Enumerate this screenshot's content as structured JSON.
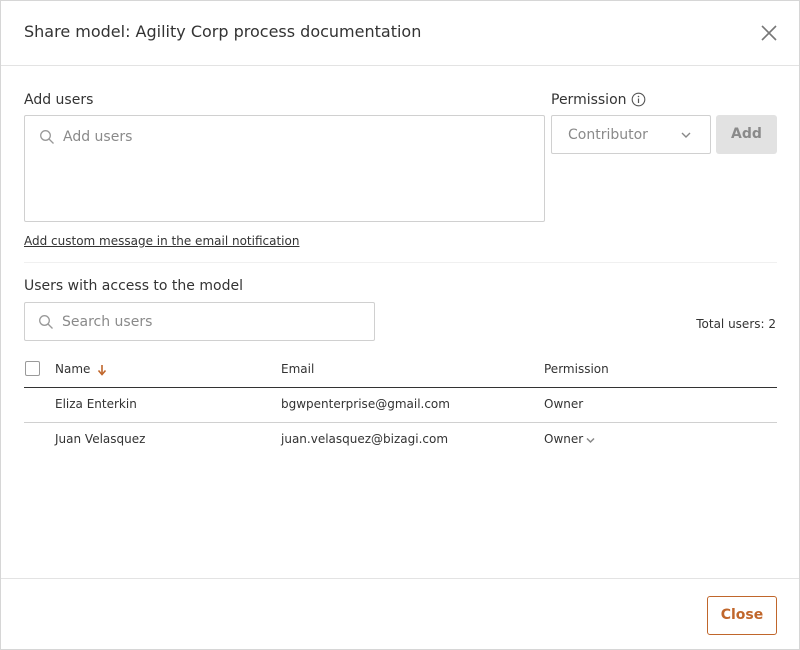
{
  "dialog": {
    "title": "Share model: Agility Corp process documentation"
  },
  "add_users": {
    "label": "Add users",
    "placeholder": "Add users",
    "custom_message_link": "Add custom message in the email notification"
  },
  "permission": {
    "label": "Permission",
    "selected": "Contributor",
    "add_label": "Add"
  },
  "access": {
    "section_label": "Users with access to the model",
    "search_placeholder": "Search users",
    "total_users": "Total users: 2",
    "columns": {
      "name": "Name",
      "email": "Email",
      "permission": "Permission"
    },
    "rows": [
      {
        "name": "Eliza Enterkin",
        "email": "bgwpenterprise@gmail.com",
        "permission": "Owner"
      },
      {
        "name": "Juan Velasquez",
        "email": "juan.velasquez@bizagi.com",
        "permission": "Owner"
      }
    ]
  },
  "footer": {
    "close_label": "Close"
  },
  "colors": {
    "accent": "#c0662b",
    "text": "#333333",
    "border": "#d0d0d0",
    "disabled_button": "#e2e2e2"
  },
  "icons": {
    "close": "close-icon",
    "search": "search-icon",
    "info": "info-icon",
    "dropdown": "chevron-down-icon",
    "sort": "sort-arrow-down-icon"
  }
}
